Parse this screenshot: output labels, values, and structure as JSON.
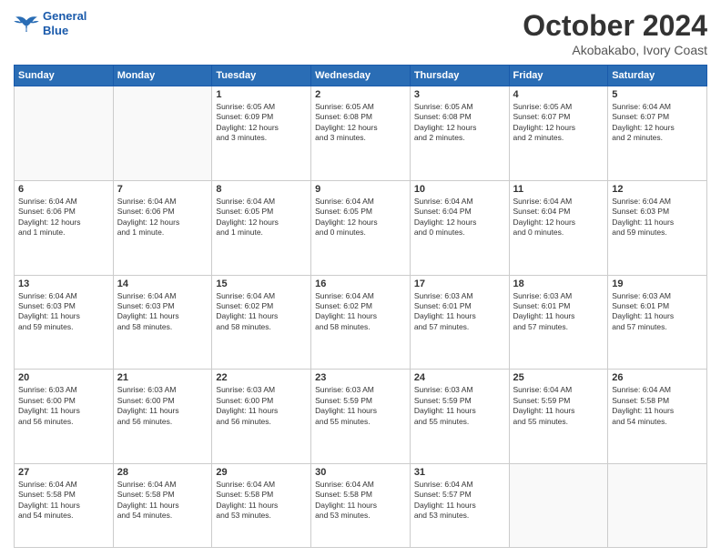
{
  "header": {
    "logo_line1": "General",
    "logo_line2": "Blue",
    "month": "October 2024",
    "location": "Akobakabo, Ivory Coast"
  },
  "weekdays": [
    "Sunday",
    "Monday",
    "Tuesday",
    "Wednesday",
    "Thursday",
    "Friday",
    "Saturday"
  ],
  "weeks": [
    [
      {
        "day": "",
        "info": ""
      },
      {
        "day": "",
        "info": ""
      },
      {
        "day": "1",
        "info": "Sunrise: 6:05 AM\nSunset: 6:09 PM\nDaylight: 12 hours\nand 3 minutes."
      },
      {
        "day": "2",
        "info": "Sunrise: 6:05 AM\nSunset: 6:08 PM\nDaylight: 12 hours\nand 3 minutes."
      },
      {
        "day": "3",
        "info": "Sunrise: 6:05 AM\nSunset: 6:08 PM\nDaylight: 12 hours\nand 2 minutes."
      },
      {
        "day": "4",
        "info": "Sunrise: 6:05 AM\nSunset: 6:07 PM\nDaylight: 12 hours\nand 2 minutes."
      },
      {
        "day": "5",
        "info": "Sunrise: 6:04 AM\nSunset: 6:07 PM\nDaylight: 12 hours\nand 2 minutes."
      }
    ],
    [
      {
        "day": "6",
        "info": "Sunrise: 6:04 AM\nSunset: 6:06 PM\nDaylight: 12 hours\nand 1 minute."
      },
      {
        "day": "7",
        "info": "Sunrise: 6:04 AM\nSunset: 6:06 PM\nDaylight: 12 hours\nand 1 minute."
      },
      {
        "day": "8",
        "info": "Sunrise: 6:04 AM\nSunset: 6:05 PM\nDaylight: 12 hours\nand 1 minute."
      },
      {
        "day": "9",
        "info": "Sunrise: 6:04 AM\nSunset: 6:05 PM\nDaylight: 12 hours\nand 0 minutes."
      },
      {
        "day": "10",
        "info": "Sunrise: 6:04 AM\nSunset: 6:04 PM\nDaylight: 12 hours\nand 0 minutes."
      },
      {
        "day": "11",
        "info": "Sunrise: 6:04 AM\nSunset: 6:04 PM\nDaylight: 12 hours\nand 0 minutes."
      },
      {
        "day": "12",
        "info": "Sunrise: 6:04 AM\nSunset: 6:03 PM\nDaylight: 11 hours\nand 59 minutes."
      }
    ],
    [
      {
        "day": "13",
        "info": "Sunrise: 6:04 AM\nSunset: 6:03 PM\nDaylight: 11 hours\nand 59 minutes."
      },
      {
        "day": "14",
        "info": "Sunrise: 6:04 AM\nSunset: 6:03 PM\nDaylight: 11 hours\nand 58 minutes."
      },
      {
        "day": "15",
        "info": "Sunrise: 6:04 AM\nSunset: 6:02 PM\nDaylight: 11 hours\nand 58 minutes."
      },
      {
        "day": "16",
        "info": "Sunrise: 6:04 AM\nSunset: 6:02 PM\nDaylight: 11 hours\nand 58 minutes."
      },
      {
        "day": "17",
        "info": "Sunrise: 6:03 AM\nSunset: 6:01 PM\nDaylight: 11 hours\nand 57 minutes."
      },
      {
        "day": "18",
        "info": "Sunrise: 6:03 AM\nSunset: 6:01 PM\nDaylight: 11 hours\nand 57 minutes."
      },
      {
        "day": "19",
        "info": "Sunrise: 6:03 AM\nSunset: 6:01 PM\nDaylight: 11 hours\nand 57 minutes."
      }
    ],
    [
      {
        "day": "20",
        "info": "Sunrise: 6:03 AM\nSunset: 6:00 PM\nDaylight: 11 hours\nand 56 minutes."
      },
      {
        "day": "21",
        "info": "Sunrise: 6:03 AM\nSunset: 6:00 PM\nDaylight: 11 hours\nand 56 minutes."
      },
      {
        "day": "22",
        "info": "Sunrise: 6:03 AM\nSunset: 6:00 PM\nDaylight: 11 hours\nand 56 minutes."
      },
      {
        "day": "23",
        "info": "Sunrise: 6:03 AM\nSunset: 5:59 PM\nDaylight: 11 hours\nand 55 minutes."
      },
      {
        "day": "24",
        "info": "Sunrise: 6:03 AM\nSunset: 5:59 PM\nDaylight: 11 hours\nand 55 minutes."
      },
      {
        "day": "25",
        "info": "Sunrise: 6:04 AM\nSunset: 5:59 PM\nDaylight: 11 hours\nand 55 minutes."
      },
      {
        "day": "26",
        "info": "Sunrise: 6:04 AM\nSunset: 5:58 PM\nDaylight: 11 hours\nand 54 minutes."
      }
    ],
    [
      {
        "day": "27",
        "info": "Sunrise: 6:04 AM\nSunset: 5:58 PM\nDaylight: 11 hours\nand 54 minutes."
      },
      {
        "day": "28",
        "info": "Sunrise: 6:04 AM\nSunset: 5:58 PM\nDaylight: 11 hours\nand 54 minutes."
      },
      {
        "day": "29",
        "info": "Sunrise: 6:04 AM\nSunset: 5:58 PM\nDaylight: 11 hours\nand 53 minutes."
      },
      {
        "day": "30",
        "info": "Sunrise: 6:04 AM\nSunset: 5:58 PM\nDaylight: 11 hours\nand 53 minutes."
      },
      {
        "day": "31",
        "info": "Sunrise: 6:04 AM\nSunset: 5:57 PM\nDaylight: 11 hours\nand 53 minutes."
      },
      {
        "day": "",
        "info": ""
      },
      {
        "day": "",
        "info": ""
      }
    ]
  ]
}
